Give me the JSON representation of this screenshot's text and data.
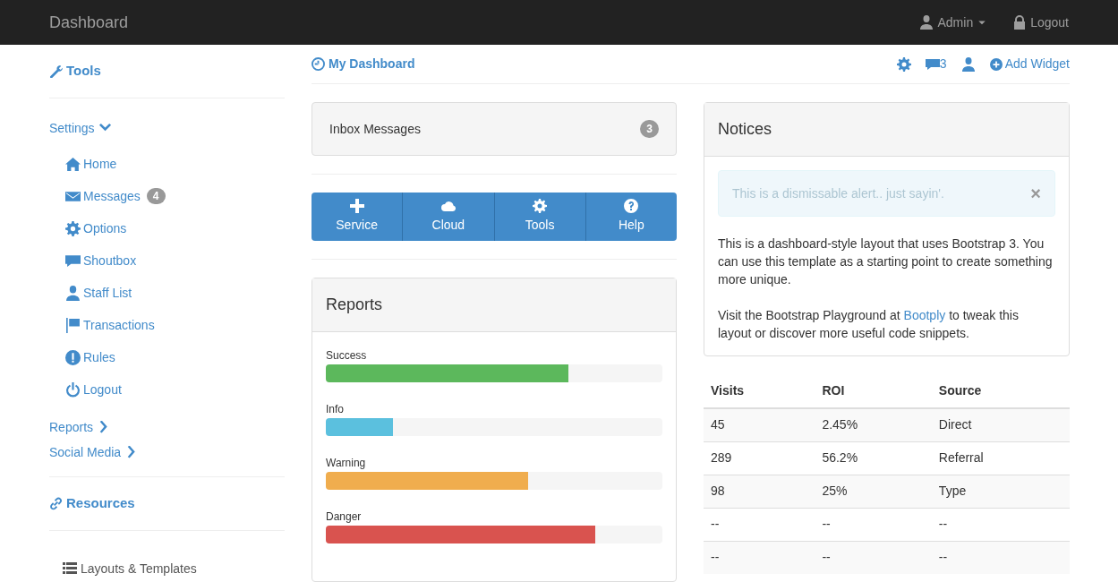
{
  "navbar": {
    "brand": "Dashboard",
    "user": "Admin",
    "logout": "Logout"
  },
  "sidebar": {
    "tools_heading": "Tools",
    "menu": [
      {
        "label": "Settings",
        "expanded": true,
        "children": [
          {
            "label": "Home"
          },
          {
            "label": "Messages",
            "badge": "4"
          },
          {
            "label": "Options"
          },
          {
            "label": "Shoutbox"
          },
          {
            "label": "Staff List"
          },
          {
            "label": "Transactions"
          },
          {
            "label": "Rules"
          },
          {
            "label": "Logout"
          }
        ]
      },
      {
        "label": "Reports",
        "expanded": false
      },
      {
        "label": "Social Media",
        "expanded": false
      }
    ],
    "resources_heading": "Resources",
    "resources": [
      {
        "label": "Layouts & Templates"
      }
    ]
  },
  "header": {
    "title": "My Dashboard",
    "message_count": "3",
    "add_widget": "Add Widget"
  },
  "inbox": {
    "label": "Inbox Messages",
    "count": "3"
  },
  "button_bar": [
    {
      "label": "Service"
    },
    {
      "label": "Cloud"
    },
    {
      "label": "Tools"
    },
    {
      "label": "Help"
    }
  ],
  "reports": {
    "title": "Reports",
    "bars": [
      {
        "label": "Success",
        "level": 0.72,
        "color": "#5cb85c"
      },
      {
        "label": "Info",
        "level": 0.2,
        "color": "#5bc0de"
      },
      {
        "label": "Warning",
        "level": 0.6,
        "color": "#f0ad4e"
      },
      {
        "label": "Danger",
        "level": 0.8,
        "color": "#d9534f"
      }
    ]
  },
  "notices": {
    "title": "Notices",
    "alert": "This is a dismissable alert.. just sayin'.",
    "alert_close": "×",
    "paragraphs": [
      "This is a dashboard-style layout that uses Bootstrap 3. You can use this template as a starting point to create something more unique."
    ],
    "link_paragraph": {
      "before": "Visit the Bootstrap Playground at",
      "link": "Bootply",
      "after": "to tweak this layout or discover more useful code snippets."
    }
  },
  "table": {
    "columns": [
      "Visits",
      "ROI",
      "Source"
    ],
    "rows": [
      [
        "45",
        "2.45%",
        "Direct"
      ],
      [
        "289",
        "56.2%",
        "Referral"
      ],
      [
        "98",
        "25%",
        "Type"
      ],
      [
        "--",
        "--",
        "--"
      ],
      [
        "--",
        "--",
        "--"
      ]
    ]
  }
}
